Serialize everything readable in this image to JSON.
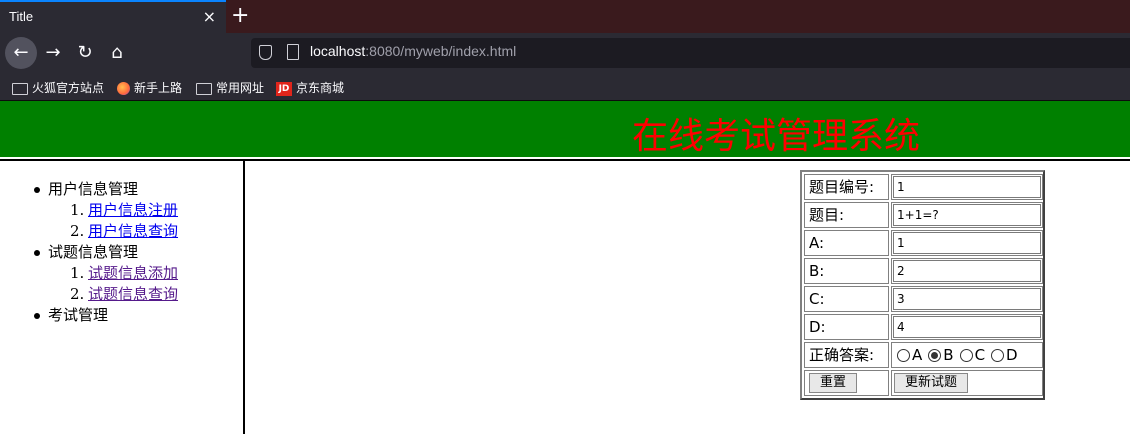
{
  "browser": {
    "tab_title": "Title",
    "tab_close": "×",
    "new_tab": "+",
    "url_host": "localhost",
    "url_rest": ":8080/myweb/index.html",
    "bookmarks": [
      "火狐官方站点",
      "新手上路",
      "常用网址",
      "京东商城"
    ],
    "jd_logo": "JD"
  },
  "banner": {
    "title": "在线考试管理系统",
    "background": "#008000",
    "title_color": "#ff0000"
  },
  "menu": {
    "group1": "用户信息管理",
    "group1_items": [
      "用户信息注册",
      "用户信息查询"
    ],
    "group2": "试题信息管理",
    "group2_items": [
      "试题信息添加",
      "试题信息查询"
    ],
    "group3": "考试管理"
  },
  "form": {
    "id_label": "题目编号:",
    "id_value": "1",
    "question_label": "题目:",
    "question_value": "1+1=?",
    "a_label": "A:",
    "a_value": "1",
    "b_label": "B:",
    "b_value": "2",
    "c_label": "C:",
    "c_value": "3",
    "d_label": "D:",
    "d_value": "4",
    "answer_label": "正确答案:",
    "answer_options": [
      "A",
      "B",
      "C",
      "D"
    ],
    "answer_selected": "B",
    "reset_label": "重置",
    "submit_label": "更新试题"
  }
}
